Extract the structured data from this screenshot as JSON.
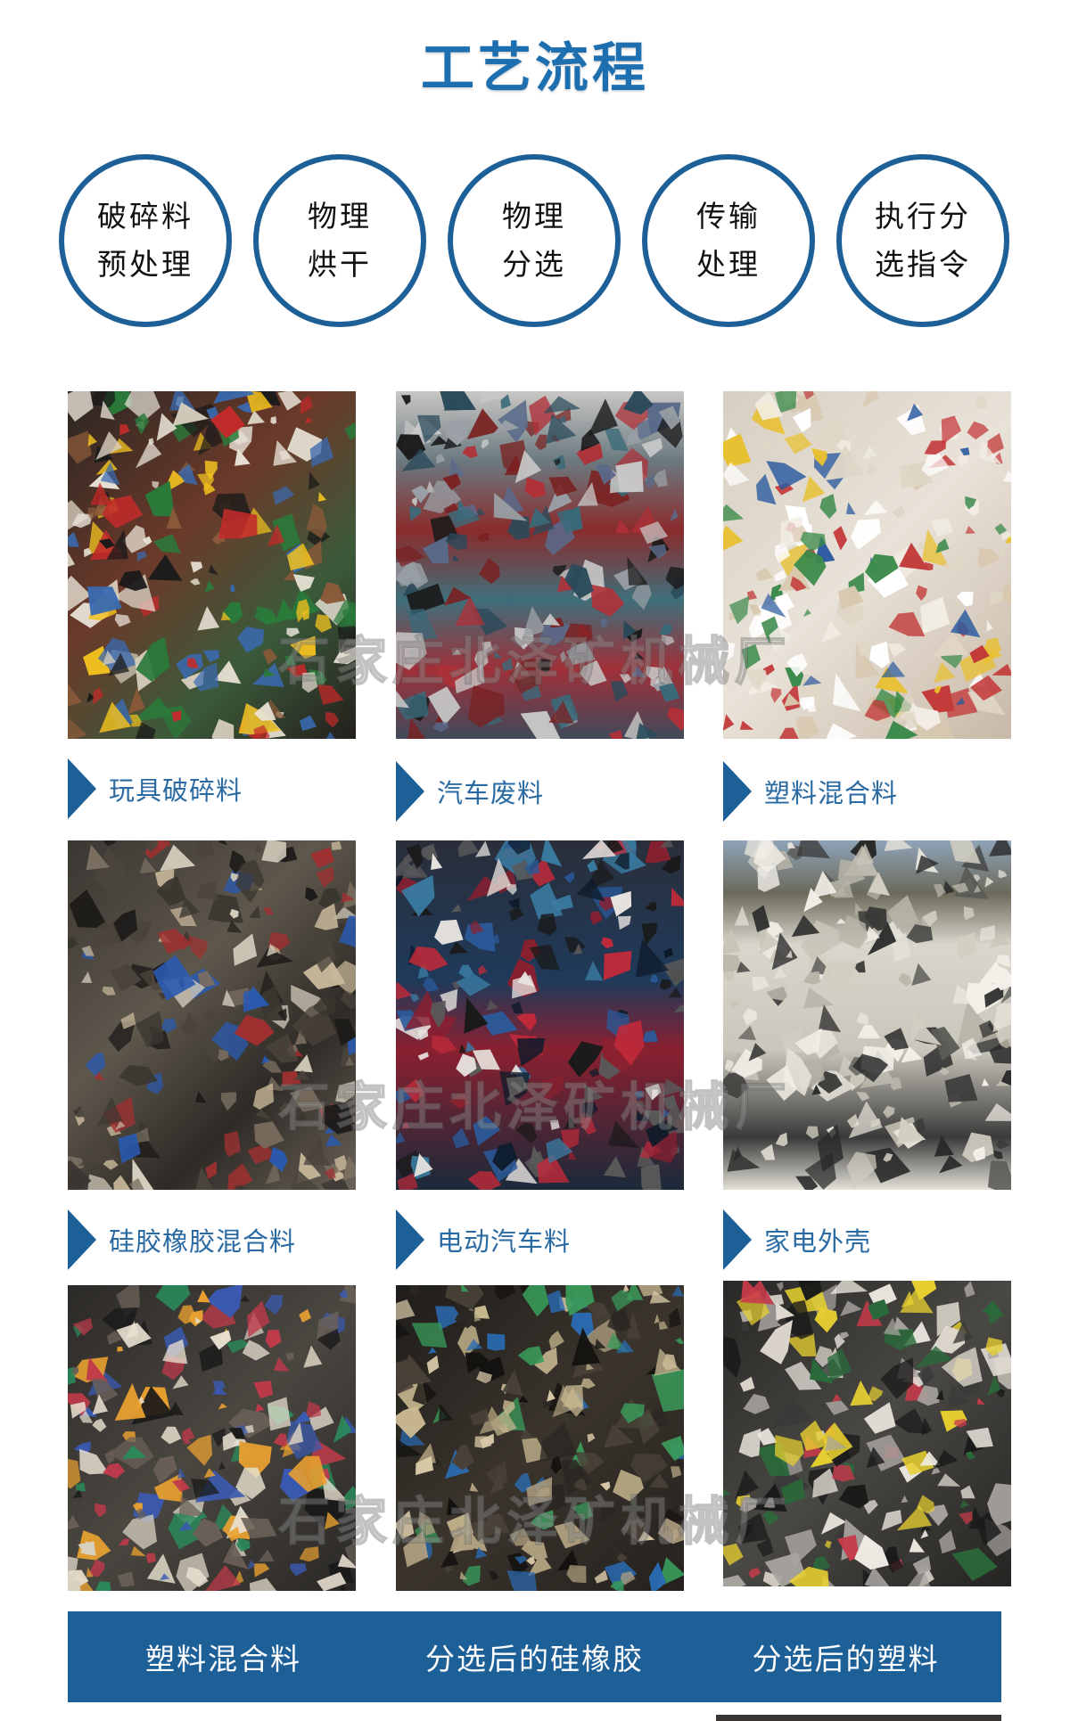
{
  "page_title": "工艺流程",
  "steps": [
    {
      "line1": "破碎料",
      "line2": "预处理"
    },
    {
      "line1": "物理",
      "line2": "烘干"
    },
    {
      "line1": "物理",
      "line2": "分选"
    },
    {
      "line1": "传输",
      "line2": "处理"
    },
    {
      "line1": "执行分",
      "line2": "选指令"
    }
  ],
  "materials": [
    {
      "caption": "玩具破碎料",
      "photo": "toy-scrap-photo"
    },
    {
      "caption": "汽车废料",
      "photo": "car-scrap-photo"
    },
    {
      "caption": "塑料混合料",
      "photo": "plastic-mix-photo"
    },
    {
      "caption": "硅胶橡胶混合料",
      "photo": "silicone-rubber-mix-photo"
    },
    {
      "caption": "电动汽车料",
      "photo": "electric-vehicle-scrap-photo"
    },
    {
      "caption": "家电外壳",
      "photo": "appliance-shell-photo"
    }
  ],
  "results": [
    {
      "caption": "塑料混合料",
      "photo": "plastic-mix-result-photo"
    },
    {
      "caption": "分选后的硅橡胶",
      "photo": "sorted-silicone-rubber-photo"
    },
    {
      "caption": "分选后的塑料",
      "photo": "sorted-plastic-photo"
    }
  ],
  "watermark": "石家庄北泽矿机械厂",
  "colors": {
    "accent": "#1d5f97",
    "title": "#1e6fb0",
    "caption": "#2a6aa3"
  }
}
